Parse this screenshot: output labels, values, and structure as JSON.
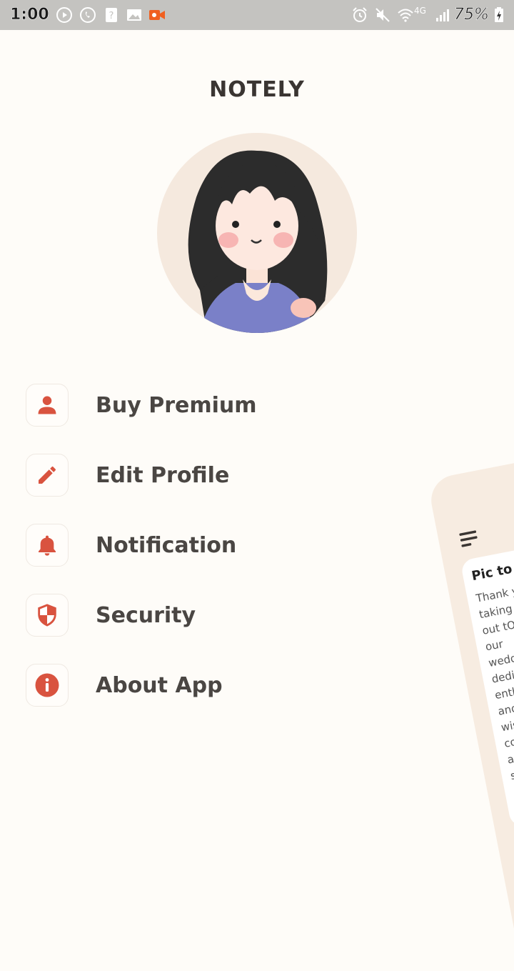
{
  "status_bar": {
    "time": "1:00",
    "battery_percent": "75%",
    "network": "4G"
  },
  "app": {
    "title": "NOTELY"
  },
  "menu": {
    "items": [
      {
        "label": "Buy Premium",
        "icon": "person-icon"
      },
      {
        "label": "Edit Profile",
        "icon": "pencil-icon"
      },
      {
        "label": "Notification",
        "icon": "bell-icon"
      },
      {
        "label": "Security",
        "icon": "shield-icon"
      },
      {
        "label": "About App",
        "icon": "info-icon"
      }
    ]
  },
  "preview": {
    "note_title": "Pic to tex",
    "note_lines": [
      "Thank you",
      "taking tim",
      "out tO co",
      "our",
      "weddin",
      "dedica",
      "enthu",
      "and",
      "wish",
      "com",
      "app",
      "sur"
    ]
  },
  "colors": {
    "accent": "#d9533f",
    "background": "#fefcf8",
    "text": "#4a4643"
  }
}
